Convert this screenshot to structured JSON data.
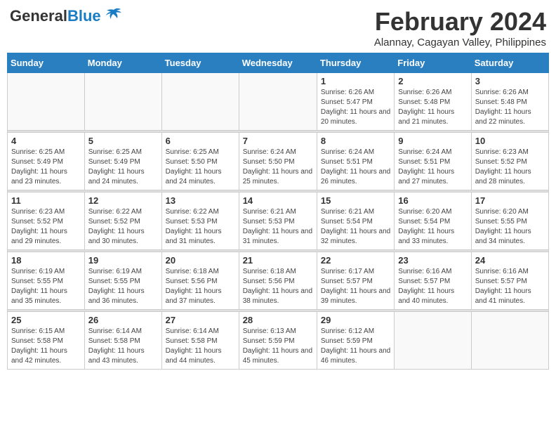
{
  "logo": {
    "general": "General",
    "blue": "Blue"
  },
  "header": {
    "month_year": "February 2024",
    "location": "Alannay, Cagayan Valley, Philippines"
  },
  "weekdays": [
    "Sunday",
    "Monday",
    "Tuesday",
    "Wednesday",
    "Thursday",
    "Friday",
    "Saturday"
  ],
  "weeks": [
    [
      {
        "day": "",
        "info": ""
      },
      {
        "day": "",
        "info": ""
      },
      {
        "day": "",
        "info": ""
      },
      {
        "day": "",
        "info": ""
      },
      {
        "day": "1",
        "info": "Sunrise: 6:26 AM\nSunset: 5:47 PM\nDaylight: 11 hours and 20 minutes."
      },
      {
        "day": "2",
        "info": "Sunrise: 6:26 AM\nSunset: 5:48 PM\nDaylight: 11 hours and 21 minutes."
      },
      {
        "day": "3",
        "info": "Sunrise: 6:26 AM\nSunset: 5:48 PM\nDaylight: 11 hours and 22 minutes."
      }
    ],
    [
      {
        "day": "4",
        "info": "Sunrise: 6:25 AM\nSunset: 5:49 PM\nDaylight: 11 hours and 23 minutes."
      },
      {
        "day": "5",
        "info": "Sunrise: 6:25 AM\nSunset: 5:49 PM\nDaylight: 11 hours and 24 minutes."
      },
      {
        "day": "6",
        "info": "Sunrise: 6:25 AM\nSunset: 5:50 PM\nDaylight: 11 hours and 24 minutes."
      },
      {
        "day": "7",
        "info": "Sunrise: 6:24 AM\nSunset: 5:50 PM\nDaylight: 11 hours and 25 minutes."
      },
      {
        "day": "8",
        "info": "Sunrise: 6:24 AM\nSunset: 5:51 PM\nDaylight: 11 hours and 26 minutes."
      },
      {
        "day": "9",
        "info": "Sunrise: 6:24 AM\nSunset: 5:51 PM\nDaylight: 11 hours and 27 minutes."
      },
      {
        "day": "10",
        "info": "Sunrise: 6:23 AM\nSunset: 5:52 PM\nDaylight: 11 hours and 28 minutes."
      }
    ],
    [
      {
        "day": "11",
        "info": "Sunrise: 6:23 AM\nSunset: 5:52 PM\nDaylight: 11 hours and 29 minutes."
      },
      {
        "day": "12",
        "info": "Sunrise: 6:22 AM\nSunset: 5:52 PM\nDaylight: 11 hours and 30 minutes."
      },
      {
        "day": "13",
        "info": "Sunrise: 6:22 AM\nSunset: 5:53 PM\nDaylight: 11 hours and 31 minutes."
      },
      {
        "day": "14",
        "info": "Sunrise: 6:21 AM\nSunset: 5:53 PM\nDaylight: 11 hours and 31 minutes."
      },
      {
        "day": "15",
        "info": "Sunrise: 6:21 AM\nSunset: 5:54 PM\nDaylight: 11 hours and 32 minutes."
      },
      {
        "day": "16",
        "info": "Sunrise: 6:20 AM\nSunset: 5:54 PM\nDaylight: 11 hours and 33 minutes."
      },
      {
        "day": "17",
        "info": "Sunrise: 6:20 AM\nSunset: 5:55 PM\nDaylight: 11 hours and 34 minutes."
      }
    ],
    [
      {
        "day": "18",
        "info": "Sunrise: 6:19 AM\nSunset: 5:55 PM\nDaylight: 11 hours and 35 minutes."
      },
      {
        "day": "19",
        "info": "Sunrise: 6:19 AM\nSunset: 5:55 PM\nDaylight: 11 hours and 36 minutes."
      },
      {
        "day": "20",
        "info": "Sunrise: 6:18 AM\nSunset: 5:56 PM\nDaylight: 11 hours and 37 minutes."
      },
      {
        "day": "21",
        "info": "Sunrise: 6:18 AM\nSunset: 5:56 PM\nDaylight: 11 hours and 38 minutes."
      },
      {
        "day": "22",
        "info": "Sunrise: 6:17 AM\nSunset: 5:57 PM\nDaylight: 11 hours and 39 minutes."
      },
      {
        "day": "23",
        "info": "Sunrise: 6:16 AM\nSunset: 5:57 PM\nDaylight: 11 hours and 40 minutes."
      },
      {
        "day": "24",
        "info": "Sunrise: 6:16 AM\nSunset: 5:57 PM\nDaylight: 11 hours and 41 minutes."
      }
    ],
    [
      {
        "day": "25",
        "info": "Sunrise: 6:15 AM\nSunset: 5:58 PM\nDaylight: 11 hours and 42 minutes."
      },
      {
        "day": "26",
        "info": "Sunrise: 6:14 AM\nSunset: 5:58 PM\nDaylight: 11 hours and 43 minutes."
      },
      {
        "day": "27",
        "info": "Sunrise: 6:14 AM\nSunset: 5:58 PM\nDaylight: 11 hours and 44 minutes."
      },
      {
        "day": "28",
        "info": "Sunrise: 6:13 AM\nSunset: 5:59 PM\nDaylight: 11 hours and 45 minutes."
      },
      {
        "day": "29",
        "info": "Sunrise: 6:12 AM\nSunset: 5:59 PM\nDaylight: 11 hours and 46 minutes."
      },
      {
        "day": "",
        "info": ""
      },
      {
        "day": "",
        "info": ""
      }
    ]
  ]
}
